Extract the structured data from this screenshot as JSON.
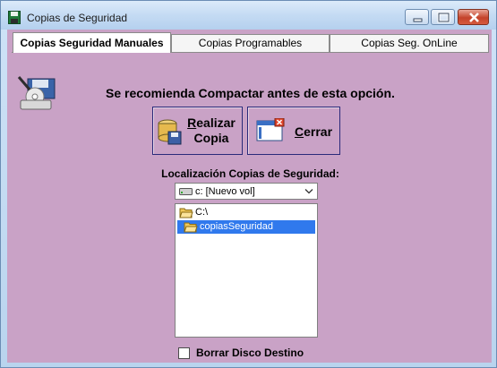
{
  "window": {
    "title": "Copias de Seguridad",
    "app_icon": "floppy-disk-icon"
  },
  "tabs": [
    {
      "label": "Copias Seguridad Manuales",
      "active": true
    },
    {
      "label": "Copias Programables",
      "active": false
    },
    {
      "label": "Copias Seg. OnLine",
      "active": false
    }
  ],
  "main": {
    "recommendation": "Se recomienda Compactar antes de esta opción.",
    "backup_button": {
      "line1": "Realizar",
      "line2": "Copia",
      "icon": "database-save-icon"
    },
    "close_button": {
      "label": "Cerrar",
      "icon": "window-close-icon"
    },
    "location_label": "Localización Copias de Seguridad:",
    "drive": {
      "selected": "c: [Nuevo vol]",
      "icon": "hard-drive-icon"
    },
    "directories": [
      {
        "label": "C:\\",
        "icon": "folder-open-icon",
        "selected": false
      },
      {
        "label": "copiasSeguridad",
        "icon": "folder-open-icon",
        "selected": true
      }
    ],
    "erase_checkbox": {
      "label": "Borrar Disco Destino",
      "checked": false
    }
  },
  "colors": {
    "panel_background": "#c9a2c6",
    "selection": "#3079ed",
    "close_button": "#c4432b"
  }
}
